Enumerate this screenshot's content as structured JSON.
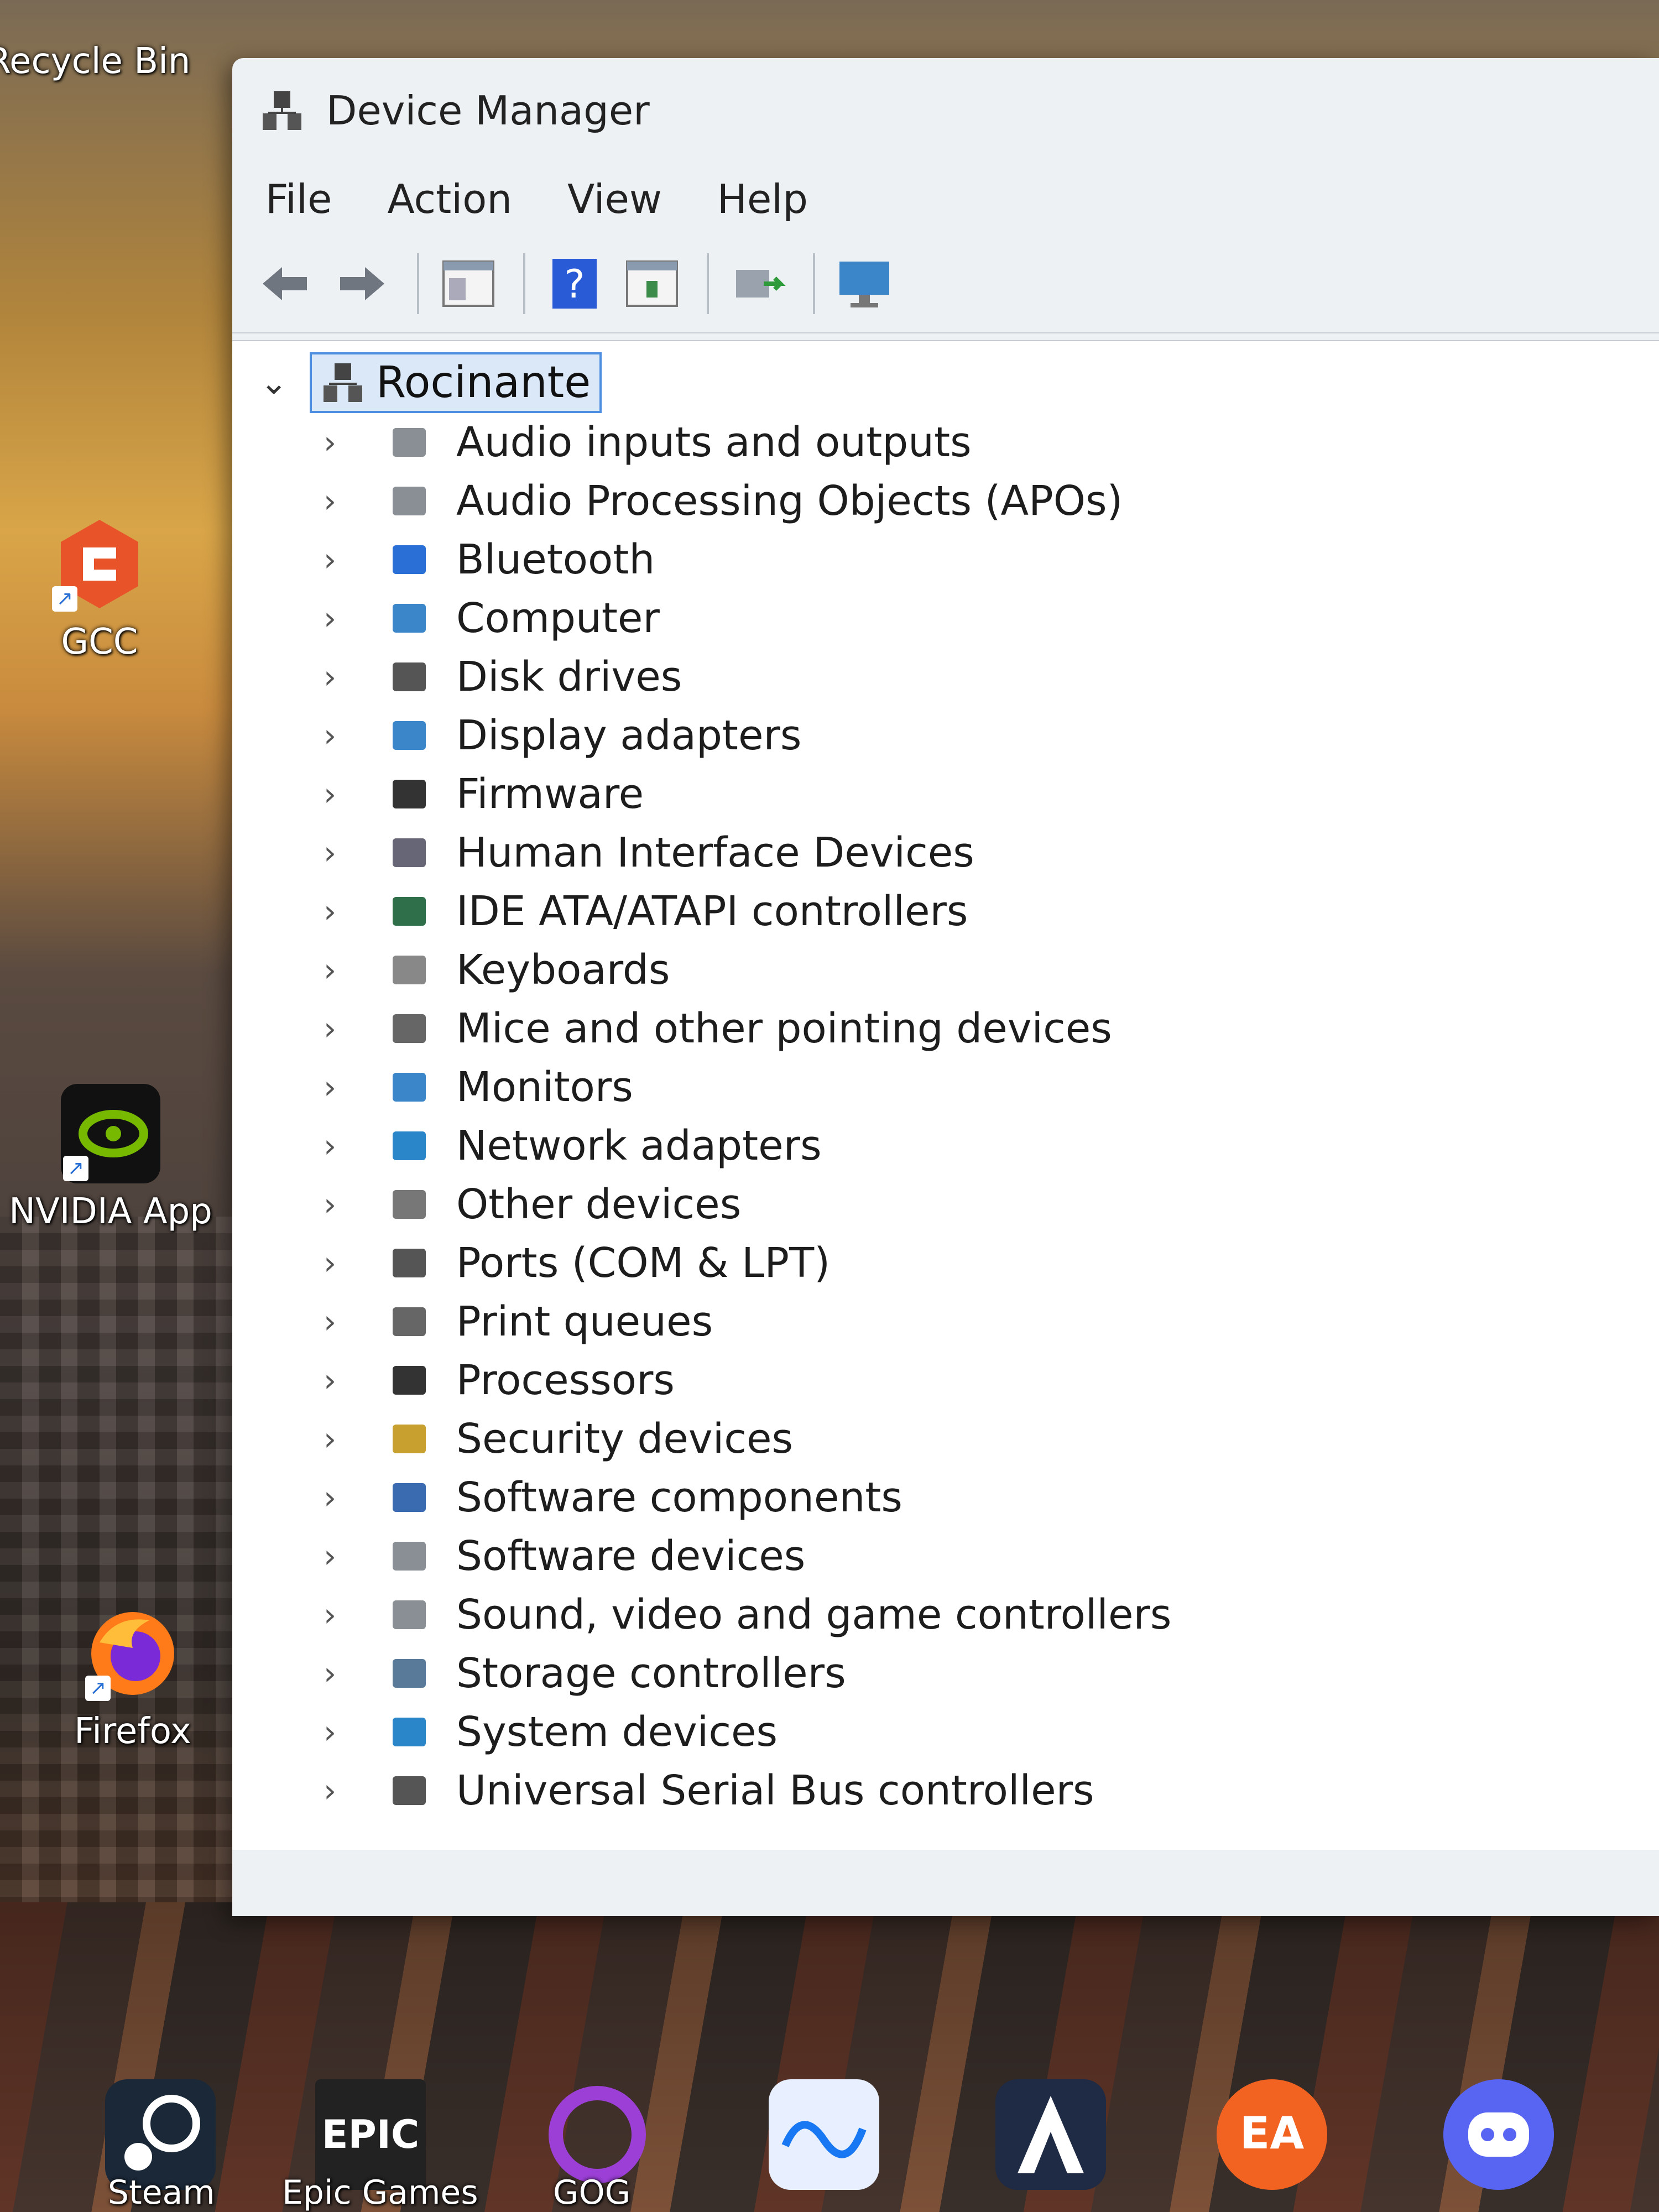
{
  "desktop": {
    "icons": [
      {
        "label": "Recycle Bin"
      },
      {
        "label": "GCC"
      },
      {
        "label": "NVIDIA App"
      },
      {
        "label": "Firefox"
      }
    ],
    "dock": [
      {
        "label": "Steam"
      },
      {
        "label": "Epic Games"
      },
      {
        "label": "GOG"
      }
    ],
    "epic_text": "EPIC"
  },
  "window": {
    "title": "Device Manager",
    "menu": [
      "File",
      "Action",
      "View",
      "Help"
    ],
    "root": "Rocinante",
    "categories": [
      "Audio inputs and outputs",
      "Audio Processing Objects (APOs)",
      "Bluetooth",
      "Computer",
      "Disk drives",
      "Display adapters",
      "Firmware",
      "Human Interface Devices",
      "IDE ATA/ATAPI controllers",
      "Keyboards",
      "Mice and other pointing devices",
      "Monitors",
      "Network adapters",
      "Other devices",
      "Ports (COM & LPT)",
      "Print queues",
      "Processors",
      "Security devices",
      "Software components",
      "Software devices",
      "Sound, video and game controllers",
      "Storage controllers",
      "System devices",
      "Universal Serial Bus controllers"
    ]
  },
  "colors": {
    "accent": "#4d8ee0",
    "window_bg": "#eef1f4",
    "tree_bg": "#ffffff"
  }
}
